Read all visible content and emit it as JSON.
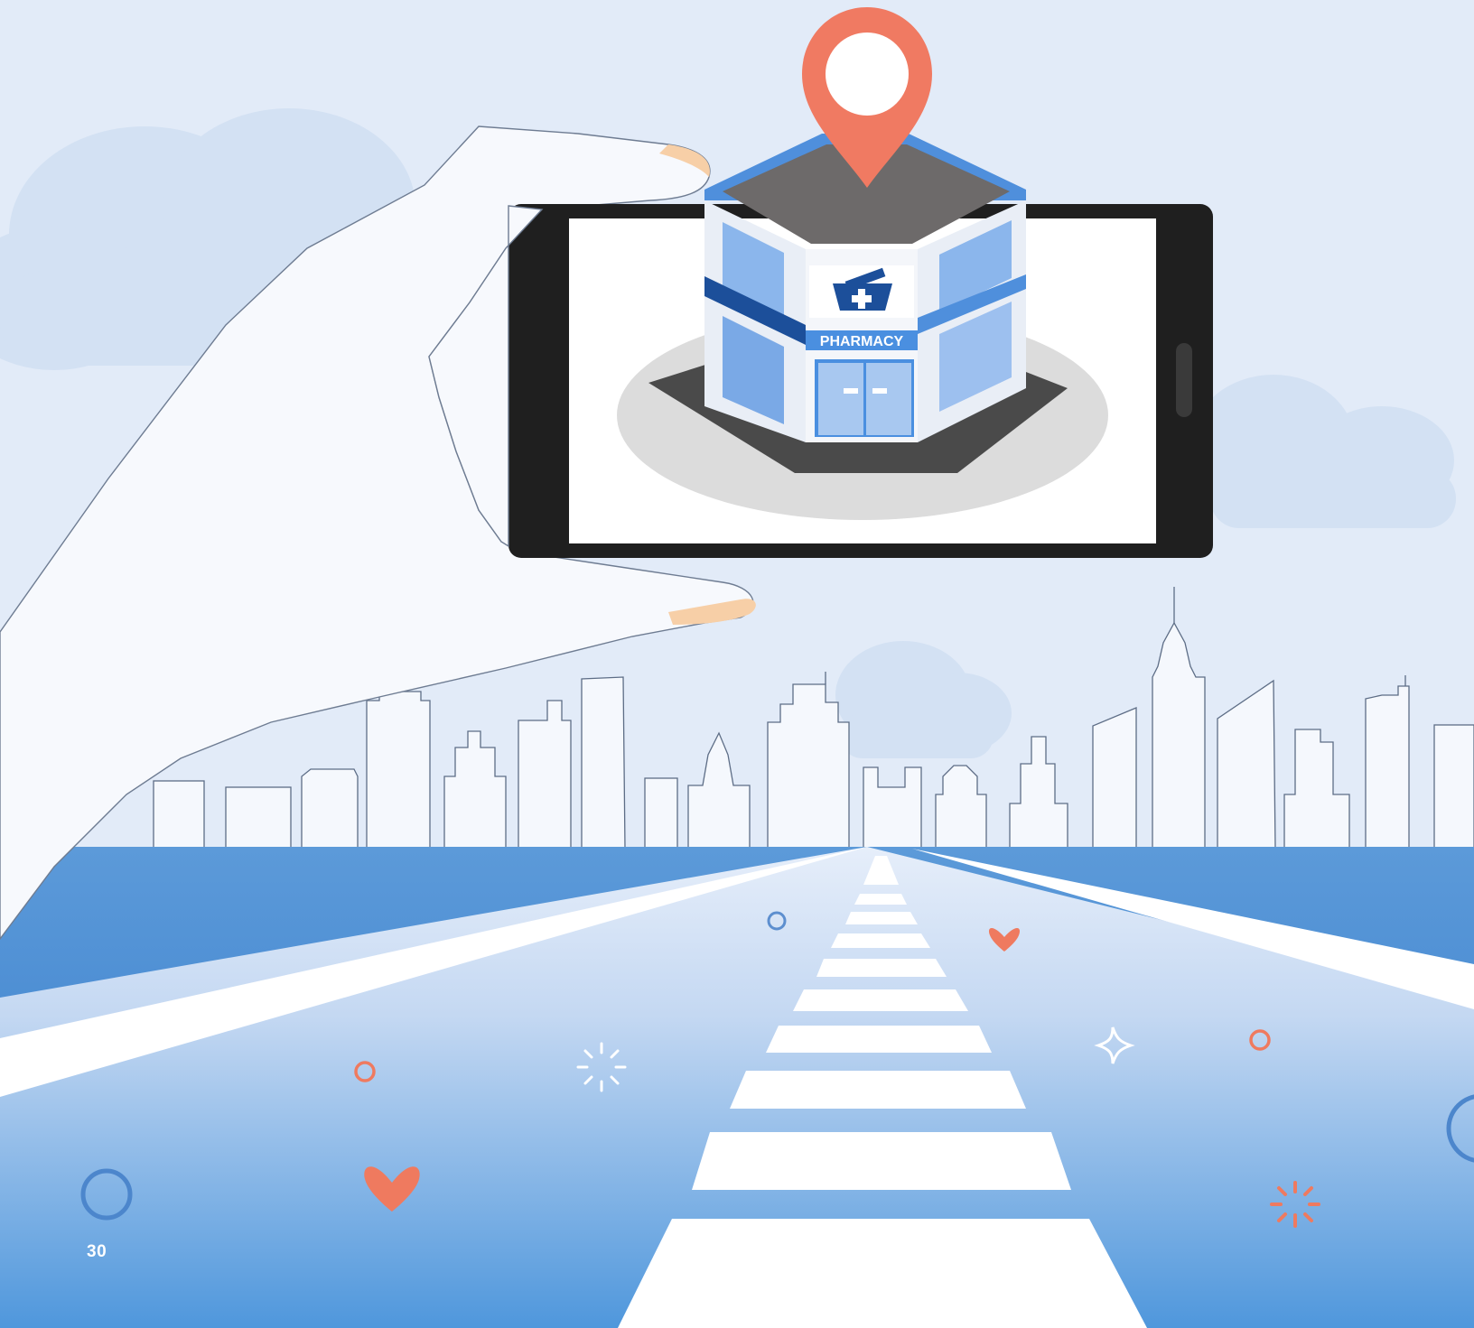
{
  "illustration": {
    "sign_text": "PHARMACY",
    "page_number": "30",
    "icons": [
      "location-pin-icon",
      "mortar-pestle-icon",
      "cross-icon",
      "heart-icon",
      "ring-icon",
      "sparkle-icon",
      "cloud-icon"
    ]
  },
  "colors": {
    "sky": "#e2ebf8",
    "road_blue": "#4c8fd8",
    "road_light": "#b9d0f0",
    "pin_coral": "#f07a62",
    "building_blue": "#4a8fe0",
    "building_navy": "#1c4f9a",
    "phone_black": "#1f1f1f",
    "heart_coral": "#ef7a5f",
    "ring_blue": "#5d8fcf"
  }
}
